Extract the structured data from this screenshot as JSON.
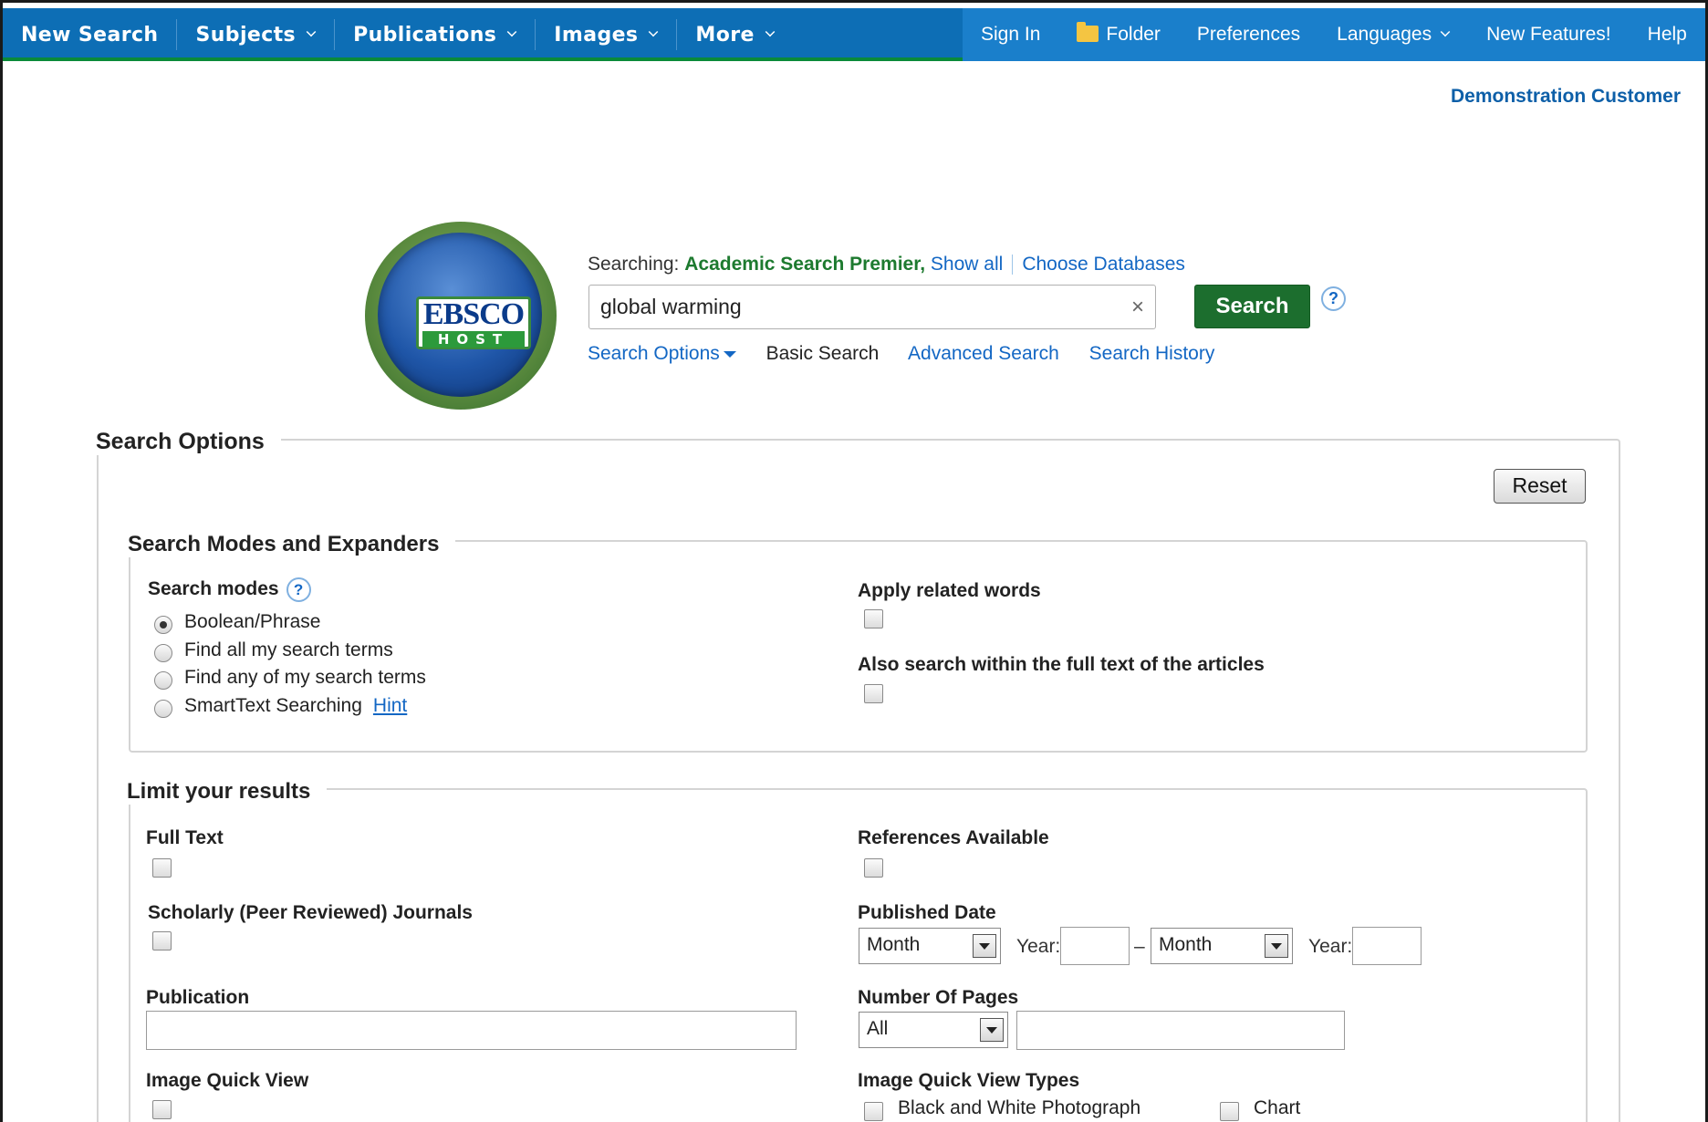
{
  "topnav": {
    "left": [
      {
        "label": "New Search",
        "dropdown": false
      },
      {
        "label": "Subjects",
        "dropdown": true
      },
      {
        "label": "Publications",
        "dropdown": true
      },
      {
        "label": "Images",
        "dropdown": true
      },
      {
        "label": "More",
        "dropdown": true
      }
    ],
    "right": {
      "sign_in": "Sign In",
      "folder": "Folder",
      "preferences": "Preferences",
      "languages": "Languages",
      "new_features": "New Features!",
      "help": "Help"
    }
  },
  "customer": "Demonstration Customer",
  "logo": {
    "line1": "EBSCO",
    "line2": "HOST"
  },
  "searching": {
    "prefix": "Searching:",
    "database": "Academic Search Premier,",
    "show_all": "Show all",
    "choose_databases": "Choose Databases"
  },
  "search": {
    "query": "global warming",
    "clear": "×",
    "button": "Search",
    "help": "?"
  },
  "search_links": {
    "options": "Search Options",
    "basic": "Basic Search",
    "advanced": "Advanced Search",
    "history": "Search History"
  },
  "search_options": {
    "title": "Search Options",
    "reset": "Reset",
    "modes_section": {
      "title": "Search Modes and Expanders",
      "modes_label": "Search modes",
      "modes_help": "?",
      "modes": [
        {
          "label": "Boolean/Phrase",
          "selected": true
        },
        {
          "label": "Find all my search terms",
          "selected": false
        },
        {
          "label": "Find any of my search terms",
          "selected": false
        },
        {
          "label": "SmartText Searching",
          "selected": false
        }
      ],
      "hint": "Hint",
      "related_words": "Apply related words",
      "full_text_search": "Also search within the full text of the articles"
    },
    "limits": {
      "title": "Limit your results",
      "full_text": "Full Text",
      "references": "References Available",
      "scholarly": "Scholarly (Peer Reviewed) Journals",
      "published_date": "Published Date",
      "month_from": "Month",
      "year_label_from": "Year:",
      "dash": "–",
      "month_to": "Month",
      "year_label_to": "Year:",
      "publication": "Publication",
      "number_of_pages": "Number Of Pages",
      "pages_select": "All",
      "image_quick_view": "Image Quick View",
      "image_quick_view_types": "Image Quick View Types",
      "types": [
        "Black and White Photograph",
        "Chart"
      ]
    }
  }
}
